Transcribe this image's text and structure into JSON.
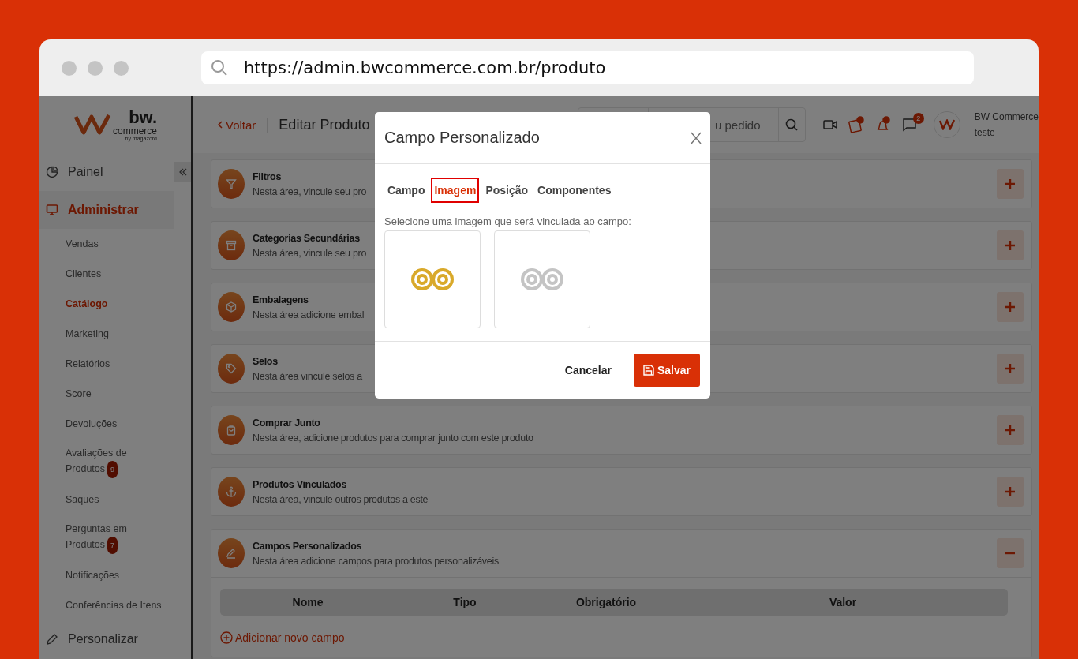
{
  "browser": {
    "url": "https://admin.bwcommerce.com.br/produto"
  },
  "logo": {
    "name": "bw.",
    "sub": "commerce",
    "by": "by magazord"
  },
  "sidebar": {
    "items": [
      {
        "label": "Painel",
        "kind": "section",
        "selected": false
      },
      {
        "label": "Administrar",
        "kind": "section",
        "selected": true
      },
      {
        "label": "Vendas",
        "kind": "sub",
        "selected": false
      },
      {
        "label": "Clientes",
        "kind": "sub",
        "selected": false
      },
      {
        "label": "Catálogo",
        "kind": "sub",
        "selected": true
      },
      {
        "label": "Marketing",
        "kind": "sub",
        "selected": false
      },
      {
        "label": "Relatórios",
        "kind": "sub",
        "selected": false
      },
      {
        "label": "Score",
        "kind": "sub",
        "selected": false
      },
      {
        "label": "Devoluções",
        "kind": "sub",
        "selected": false
      },
      {
        "label": "Avaliações de Produtos",
        "kind": "sub",
        "selected": false,
        "badge": "9"
      },
      {
        "label": "Saques",
        "kind": "sub",
        "selected": false
      },
      {
        "label": "Perguntas em Produtos",
        "kind": "sub",
        "selected": false,
        "badge": "7"
      },
      {
        "label": "Notificações",
        "kind": "sub",
        "selected": false
      },
      {
        "label": "Conferências de Itens",
        "kind": "sub",
        "selected": false
      },
      {
        "label": "Personalizar",
        "kind": "section",
        "selected": false
      }
    ]
  },
  "header": {
    "back": "Voltar",
    "title": "Editar Produto",
    "search_placeholder": "u pedido",
    "chat_badge": "2",
    "user_name": "BW Commerce",
    "user_sub": "teste"
  },
  "sections": [
    {
      "title": "Filtros",
      "description": "Nesta área, vincule seu pro",
      "expanded": false
    },
    {
      "title": "Categorias Secundárias",
      "description": "Nesta área, vincule seu pro",
      "expanded": false
    },
    {
      "title": "Embalagens",
      "description": "Nesta área adicione embal",
      "expanded": false
    },
    {
      "title": "Selos",
      "description": "Nesta área vincule selos a",
      "expanded": false
    },
    {
      "title": "Comprar Junto",
      "description": "Nesta área, adicione produtos para comprar junto com este produto",
      "expanded": false
    },
    {
      "title": "Produtos Vinculados",
      "description": "Nesta área, vincule outros produtos a este",
      "expanded": false
    },
    {
      "title": "Campos Personalizados",
      "description": "Nesta área adicione campos para produtos personalizáveis",
      "expanded": true
    }
  ],
  "fields_table": {
    "columns": [
      "Nome",
      "Tipo",
      "Obrigatório",
      "Valor"
    ],
    "add_link": "Adicionar novo campo"
  },
  "modal": {
    "title": "Campo Personalizado",
    "tabs": [
      {
        "label": "Campo",
        "selected": false
      },
      {
        "label": "Imagem",
        "selected": true
      },
      {
        "label": "Posição",
        "selected": false
      },
      {
        "label": "Componentes",
        "selected": false
      }
    ],
    "instruction": "Selecione uma imagem que será vinculada ao campo:",
    "images": [
      {
        "color": "#d9a92a"
      },
      {
        "color": "#c4c4c4"
      }
    ],
    "cancel": "Cancelar",
    "save": "Salvar"
  }
}
